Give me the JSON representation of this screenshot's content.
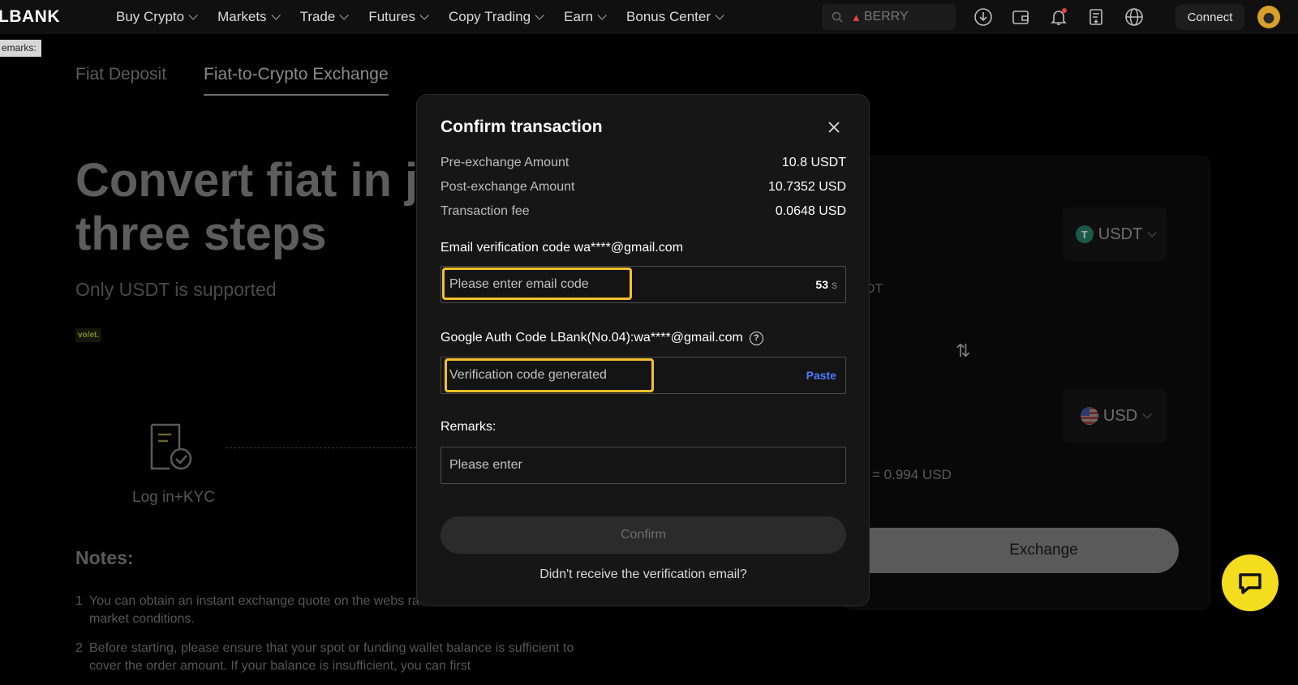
{
  "nav": {
    "logo": "LBANK",
    "menu": [
      "Buy Crypto",
      "Markets",
      "Trade",
      "Futures",
      "Copy Trading",
      "Earn",
      "Bonus Center"
    ],
    "search_placeholder": "BERRY",
    "connect_label": "Connect",
    "icons": [
      "download-icon",
      "wallet-icon",
      "bell-icon",
      "orders-icon",
      "globe-icon"
    ]
  },
  "tooltip": {
    "remarks": "emarks:"
  },
  "page": {
    "tabs": [
      "Fiat Deposit",
      "Fiat-to-Crypto Exchange"
    ],
    "hero_title": "Convert fiat in ju three steps",
    "hero_subtitle": "Only USDT is supported",
    "partner_badge": "vo/et.",
    "step_label": "Log in+KYC",
    "notes_title": "Notes:",
    "notes": [
      {
        "num": "1",
        "text": "You can obtain an instant exchange quote on the webs       rate is based on real-time market conditions."
      },
      {
        "num": "2",
        "text": "Before starting, please ensure that your spot or funding wallet balance is sufficient to cover the order amount. If your balance is insufficient, you can first"
      }
    ]
  },
  "exchange_panel": {
    "from_coin": "USDT",
    "to_coin": "USD",
    "partial_text": "DT",
    "rate_text": "= 0.994 USD",
    "exchange_label": "Exchange"
  },
  "modal": {
    "title": "Confirm transaction",
    "summary": [
      {
        "key": "Pre-exchange Amount",
        "value": "10.8 USDT"
      },
      {
        "key": "Post-exchange Amount",
        "value": "10.7352 USD"
      },
      {
        "key": "Transaction fee",
        "value": "0.0648 USD"
      }
    ],
    "email_label": "Email verification code wa****@gmail.com",
    "email_placeholder": "Please enter email code",
    "countdown": "53",
    "countdown_unit": "s",
    "google_label": "Google Auth Code LBank(No.04):wa****@gmail.com",
    "google_placeholder": "Verification code generated",
    "paste_label": "Paste",
    "remarks_label": "Remarks:",
    "remarks_placeholder": "Please enter",
    "confirm_label": "Confirm",
    "resend_label": "Didn't receive the verification email?"
  },
  "colors": {
    "accent": "#F2C02A",
    "link": "#4B7BFF",
    "chat": "#F4DD1E"
  }
}
